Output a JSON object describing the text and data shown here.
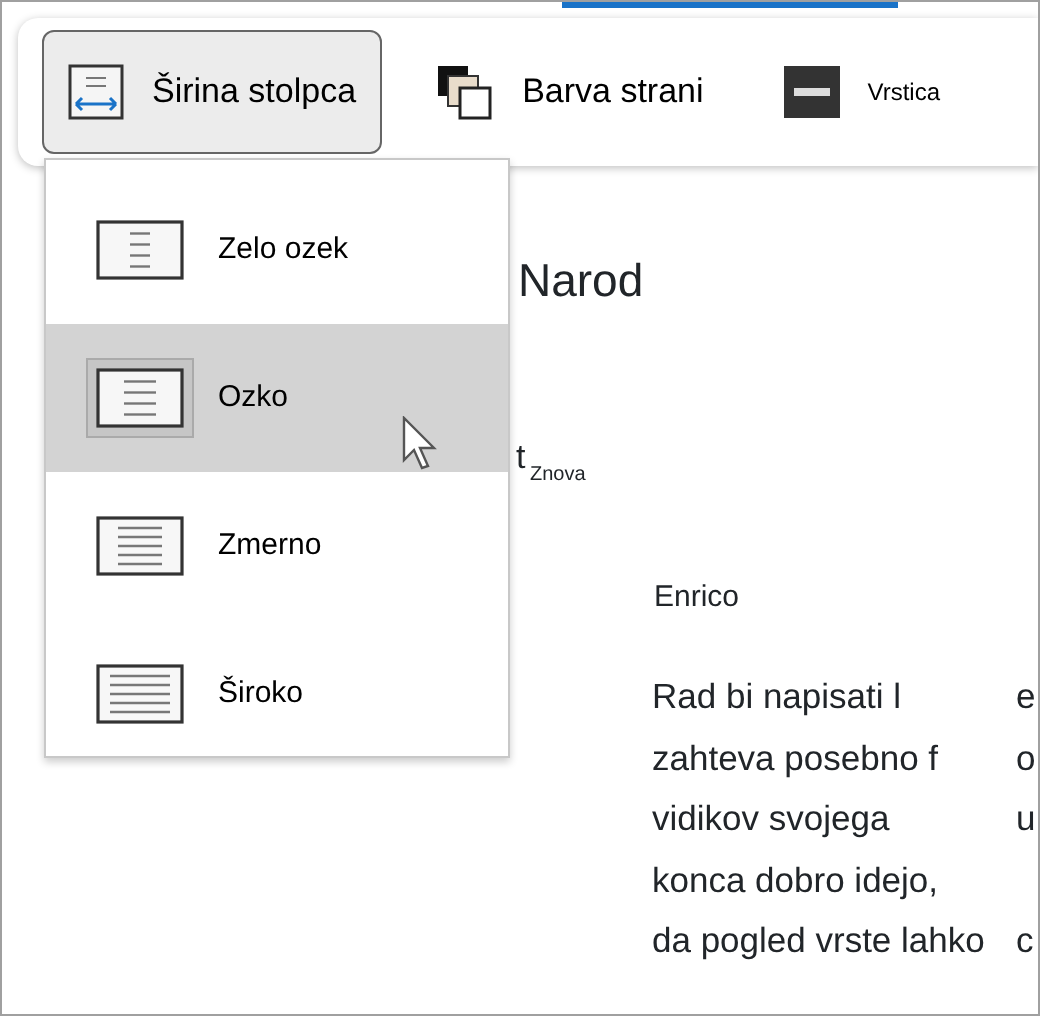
{
  "toolbar": {
    "buttons": [
      {
        "label": "Širina stolpca",
        "kind": "width",
        "expanded": true
      },
      {
        "label": "Barva strani",
        "kind": "color",
        "expanded": false
      },
      {
        "label": "Vrstica",
        "kind": "line",
        "expanded": false
      }
    ]
  },
  "menu": {
    "items": [
      {
        "label": "Zelo ozek",
        "kind": "very-narrow",
        "selected": false
      },
      {
        "label": "Ozko",
        "kind": "narrow",
        "selected": true
      },
      {
        "label": "Zmerno",
        "kind": "moderate",
        "selected": false
      },
      {
        "label": "Široko",
        "kind": "wide",
        "selected": false
      }
    ]
  },
  "document": {
    "title": "Narod",
    "mark": "t",
    "subscript": "Znova",
    "author": "Enrico",
    "lines": [
      {
        "left": "Rad bi napisati l",
        "right": "e"
      },
      {
        "left": "zahteva posebno f",
        "right": "o"
      },
      {
        "left": "vidikov svojega",
        "right": "u"
      },
      {
        "left": "konca dobro idejo,"
      },
      {
        "left": "da pogled vrste lahko",
        "right": "c"
      }
    ]
  }
}
